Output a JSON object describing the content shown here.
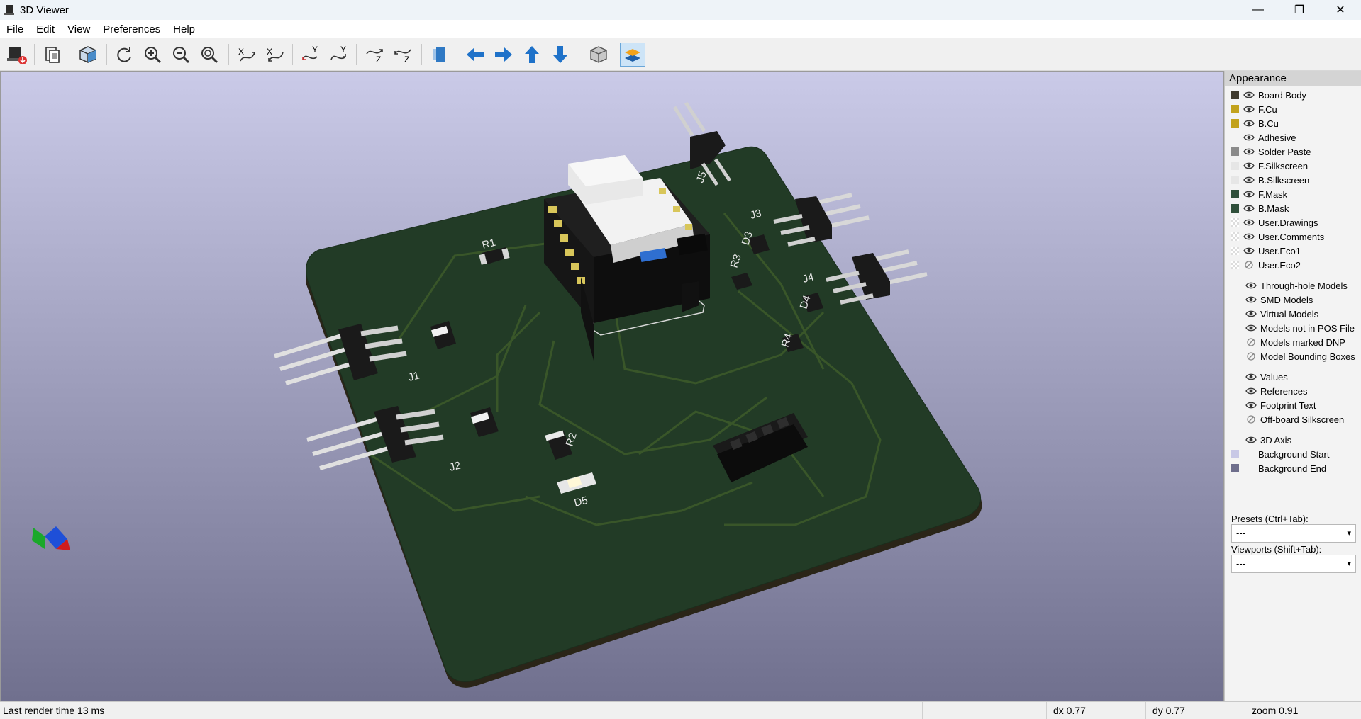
{
  "window": {
    "title": "3D Viewer",
    "minimize": "—",
    "maximize": "❐",
    "close": "✕"
  },
  "menu": [
    "File",
    "Edit",
    "View",
    "Preferences",
    "Help"
  ],
  "toolbar": [
    {
      "icon": "render-raytrace-icon"
    },
    {
      "icon": "copy-clipboard-icon"
    },
    {
      "icon": "view-3d-box-icon"
    },
    {
      "icon": "reload-icon"
    },
    {
      "icon": "zoom-in-icon"
    },
    {
      "icon": "zoom-out-icon"
    },
    {
      "icon": "zoom-fit-icon"
    },
    {
      "icon": "rotate-x-cw-icon"
    },
    {
      "icon": "rotate-x-ccw-icon"
    },
    {
      "icon": "rotate-y-cw-icon"
    },
    {
      "icon": "rotate-y-ccw-icon"
    },
    {
      "icon": "rotate-z-cw-icon"
    },
    {
      "icon": "rotate-z-ccw-icon"
    },
    {
      "icon": "flip-board-icon"
    },
    {
      "icon": "pan-left-icon"
    },
    {
      "icon": "pan-right-icon"
    },
    {
      "icon": "pan-up-icon"
    },
    {
      "icon": "pan-down-icon"
    },
    {
      "icon": "orthographic-icon"
    },
    {
      "icon": "layers-manager-icon"
    }
  ],
  "board_labels": {
    "J1": "J1",
    "J2": "J2",
    "J3": "J3",
    "J4": "J4",
    "J5": "J5",
    "R1": "R1",
    "R2": "R2",
    "R3": "R3",
    "R4": "R4",
    "D3": "D3",
    "D4": "D4",
    "D5": "D5"
  },
  "appearance": {
    "title": "Appearance",
    "layers": [
      {
        "label": "Board Body",
        "color": "#3f3a2e",
        "swatch": "solid",
        "visible": true
      },
      {
        "label": "F.Cu",
        "color": "#c2a21c",
        "swatch": "solid",
        "visible": true
      },
      {
        "label": "B.Cu",
        "color": "#c2a21c",
        "swatch": "solid",
        "visible": true
      },
      {
        "label": "Adhesive",
        "color": "",
        "swatch": "none",
        "visible": true
      },
      {
        "label": "Solder Paste",
        "color": "#8a8a8a",
        "swatch": "solid",
        "visible": true
      },
      {
        "label": "F.Silkscreen",
        "color": "#e6e6e6",
        "swatch": "solid",
        "visible": true
      },
      {
        "label": "B.Silkscreen",
        "color": "#e6e6e6",
        "swatch": "solid",
        "visible": true
      },
      {
        "label": "F.Mask",
        "color": "#2f4f3a",
        "swatch": "solid",
        "visible": true
      },
      {
        "label": "B.Mask",
        "color": "#2f4f3a",
        "swatch": "solid",
        "visible": true
      },
      {
        "label": "User.Drawings",
        "color": "",
        "swatch": "checker",
        "visible": true
      },
      {
        "label": "User.Comments",
        "color": "",
        "swatch": "checker",
        "visible": true
      },
      {
        "label": "User.Eco1",
        "color": "",
        "swatch": "checker",
        "visible": true
      },
      {
        "label": "User.Eco2",
        "color": "",
        "swatch": "checker",
        "visible": false
      }
    ],
    "models": [
      {
        "label": "Through-hole Models",
        "visible": true
      },
      {
        "label": "SMD Models",
        "visible": true
      },
      {
        "label": "Virtual Models",
        "visible": true
      },
      {
        "label": "Models not in POS File",
        "visible": true
      },
      {
        "label": "Models marked DNP",
        "visible": false
      },
      {
        "label": "Model Bounding Boxes",
        "visible": false
      }
    ],
    "text": [
      {
        "label": "Values",
        "visible": true
      },
      {
        "label": "References",
        "visible": true
      },
      {
        "label": "Footprint Text",
        "visible": true
      },
      {
        "label": "Off-board Silkscreen",
        "visible": false
      }
    ],
    "misc": [
      {
        "label": "3D Axis",
        "swatch": "none",
        "visible": true
      },
      {
        "label": "Background Start",
        "color": "#c8c8e6",
        "swatch": "solid",
        "visible": null
      },
      {
        "label": "Background End",
        "color": "#6e6e8c",
        "swatch": "solid",
        "visible": null
      }
    ],
    "presets_label": "Presets (Ctrl+Tab):",
    "presets_value": "---",
    "viewports_label": "Viewports (Shift+Tab):",
    "viewports_value": "---"
  },
  "status": {
    "render_time": "Last render time 13 ms",
    "dx": "dx 0.77",
    "dy": "dy 0.77",
    "zoom": "zoom 0.91"
  }
}
